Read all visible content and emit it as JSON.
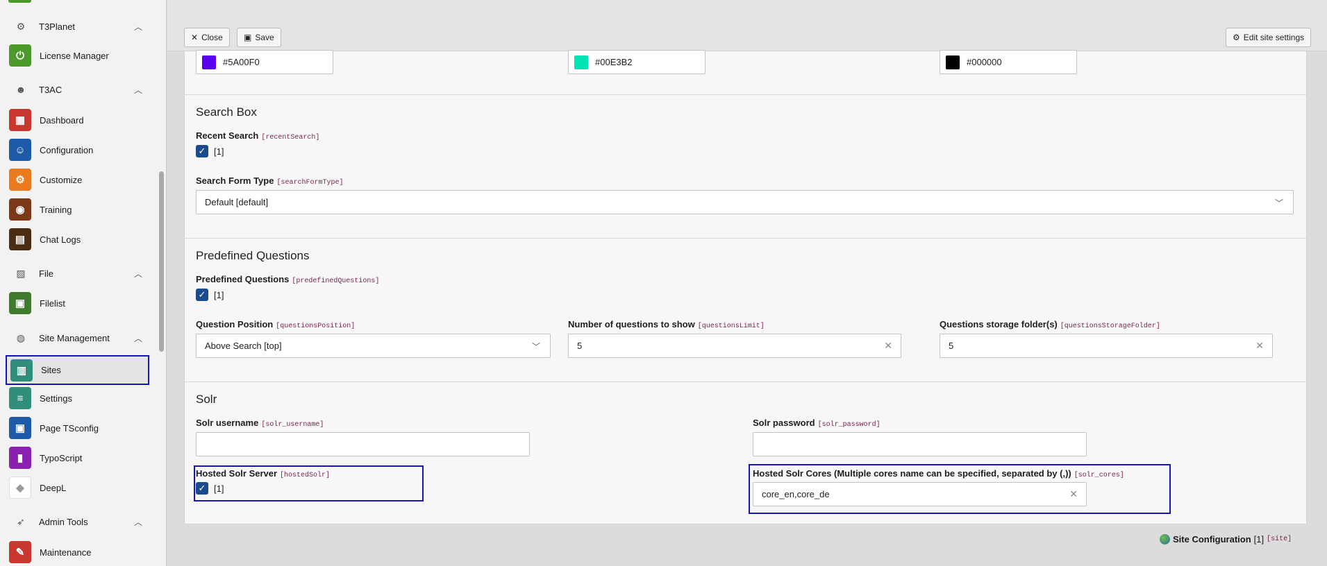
{
  "sidebar": {
    "groups": [
      {
        "label": "T3Planet",
        "icon": "gear-icon"
      },
      {
        "label": "T3AC",
        "icon": "robot-icon"
      },
      {
        "label": "File",
        "icon": "image-icon"
      },
      {
        "label": "Site Management",
        "icon": "globe-icon"
      },
      {
        "label": "Admin Tools",
        "icon": "rocket-icon"
      }
    ],
    "items": [
      {
        "label": "License Manager",
        "color": "#4c9a2a",
        "glyph": "⏻"
      },
      {
        "label": "Dashboard",
        "color": "#c8382f",
        "glyph": "▦"
      },
      {
        "label": "Configuration",
        "color": "#1d5aa8",
        "glyph": "☺"
      },
      {
        "label": "Customize",
        "color": "#ea7a1d",
        "glyph": "⚙"
      },
      {
        "label": "Training",
        "color": "#7a3a18",
        "glyph": "◉"
      },
      {
        "label": "Chat Logs",
        "color": "#4a2d12",
        "glyph": "▤"
      },
      {
        "label": "Filelist",
        "color": "#3f7a2d",
        "glyph": "▣"
      },
      {
        "label": "Sites",
        "color": "#2f8f7a",
        "glyph": "▥"
      },
      {
        "label": "Settings",
        "color": "#2f8f7a",
        "glyph": "≡"
      },
      {
        "label": "Page TSconfig",
        "color": "#1d5aa8",
        "glyph": "▣"
      },
      {
        "label": "TypoScript",
        "color": "#8b1fb0",
        "glyph": "▮"
      },
      {
        "label": "DeepL",
        "color": "#ffffff",
        "glyph": "◆"
      },
      {
        "label": "Maintenance",
        "color": "#c8382f",
        "glyph": "✎"
      }
    ]
  },
  "toolbar": {
    "close_label": "Close",
    "save_label": "Save",
    "edit_settings_label": "Edit site settings"
  },
  "colors": {
    "c1": {
      "value": "#5A00F0",
      "swatch": "#5A00F0"
    },
    "c2": {
      "value": "#00E3B2",
      "swatch": "#00E3B2"
    },
    "c3": {
      "value": "#000000",
      "swatch": "#000000"
    }
  },
  "search_box": {
    "title": "Search Box",
    "recent_label": "Recent Search",
    "recent_code": "[recentSearch]",
    "recent_value": "[1]",
    "form_type_label": "Search Form Type",
    "form_type_code": "[searchFormType]",
    "form_type_value": "Default [default]"
  },
  "predefined": {
    "title": "Predefined Questions",
    "pq_label": "Predefined Questions",
    "pq_code": "[predefinedQuestions]",
    "pq_value": "[1]",
    "position_label": "Question Position",
    "position_code": "[questionsPosition]",
    "position_value": "Above Search [top]",
    "limit_label": "Number of questions to show",
    "limit_code": "[questionsLimit]",
    "limit_value": "5",
    "folder_label": "Questions storage folder(s)",
    "folder_code": "[questionsStorageFolder]",
    "folder_value": "5"
  },
  "solr": {
    "title": "Solr",
    "username_label": "Solr username",
    "username_code": "[solr_username]",
    "username_value": "",
    "password_label": "Solr password",
    "password_code": "[solr_password]",
    "password_value": "",
    "hosted_label": "Hosted Solr Server",
    "hosted_code": "[hostedSolr]",
    "hosted_value": "[1]",
    "cores_label": "Hosted Solr Cores (Multiple cores name can be specified, separated by (,))",
    "cores_code": "[solr_cores]",
    "cores_value": "core_en,core_de"
  },
  "footer": {
    "label": "Site Configuration",
    "count": "[1]",
    "code": "[site]"
  }
}
